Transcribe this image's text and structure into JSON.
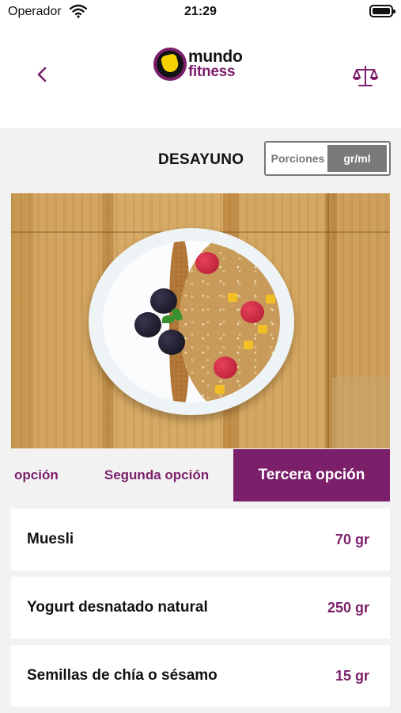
{
  "status_bar": {
    "carrier": "Operador",
    "time": "21:29"
  },
  "header": {
    "logo_line1": "mundo",
    "logo_line2": "fitness",
    "back_icon": "chevron-left-icon",
    "action_icon": "scale-icon"
  },
  "meal": {
    "title": "DESAYUNO",
    "toggle_options": [
      "Porciones",
      "gr/ml"
    ],
    "toggle_selected": "gr/ml"
  },
  "tabs": {
    "items": [
      "opción",
      "Segunda opción",
      "Tercera opción"
    ],
    "selected": "Tercera opción"
  },
  "ingredients": [
    {
      "name": "Muesli",
      "qty": "70 gr"
    },
    {
      "name": "Yogurt desnatado natural",
      "qty": "250 gr"
    },
    {
      "name": "Semillas de chía o sésamo",
      "qty": "15 gr"
    }
  ],
  "colors": {
    "brand": "#7b1f6b",
    "toggle_active": "#7a7a7a",
    "background": "#f2f2f2"
  }
}
